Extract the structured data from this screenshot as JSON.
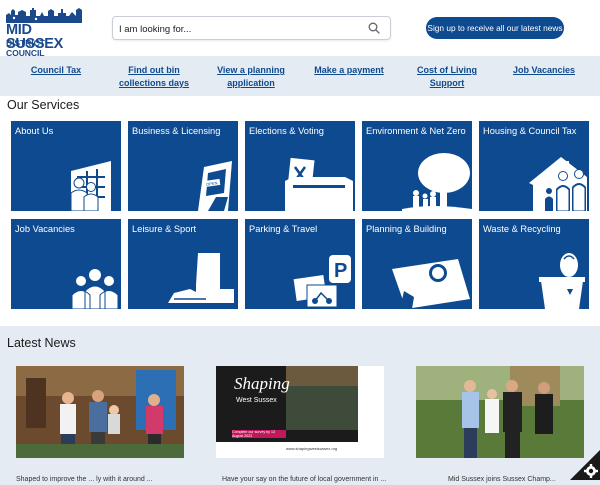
{
  "header": {
    "logo_line1": "MID SUSSEX",
    "logo_line2": "DISTRICT COUNCIL",
    "search_placeholder": "I am looking for...",
    "signup_label": "Sign up to receive all our latest news"
  },
  "quick_links": [
    {
      "label": "Council Tax"
    },
    {
      "label": "Find out bin collections days"
    },
    {
      "label": "View a planning application"
    },
    {
      "label": "Make a payment"
    },
    {
      "label": "Cost of Living Support"
    },
    {
      "label": "Job Vacancies"
    }
  ],
  "services": {
    "title": "Our Services",
    "tiles": [
      {
        "label": "About Us",
        "icon": "people-building-icon"
      },
      {
        "label": "Business & Licensing",
        "icon": "shop-open-sign-icon"
      },
      {
        "label": "Elections & Voting",
        "icon": "ballot-box-icon"
      },
      {
        "label": "Environment & Net Zero",
        "icon": "tree-family-icon"
      },
      {
        "label": "Housing & Council Tax",
        "icon": "house-family-icon"
      },
      {
        "label": "Job Vacancies",
        "icon": "group-people-icon"
      },
      {
        "label": "Leisure & Sport",
        "icon": "boot-trainer-icon"
      },
      {
        "label": "Parking & Travel",
        "icon": "parking-sign-icon"
      },
      {
        "label": "Planning & Building",
        "icon": "plan-magnifier-icon"
      },
      {
        "label": "Waste & Recycling",
        "icon": "recycling-bin-icon"
      }
    ]
  },
  "news": {
    "title": "Latest News",
    "poster_title": "Shaping",
    "poster_subtitle": "West Sussex",
    "poster_banner": "Complete our survey by 13 August 2023",
    "poster_url": "www.shapingwestsussex.org",
    "items_text": [
      "Shaped to improve the ... ly with it around ...",
      "Have your say on the future of local government in ...",
      "Mid Sussex joins Sussex Champ..."
    ]
  },
  "colors": {
    "brand_blue": "#0e4a8f",
    "page_bg": "#e4ebf2",
    "tile_bg": "#0e4a8f"
  }
}
